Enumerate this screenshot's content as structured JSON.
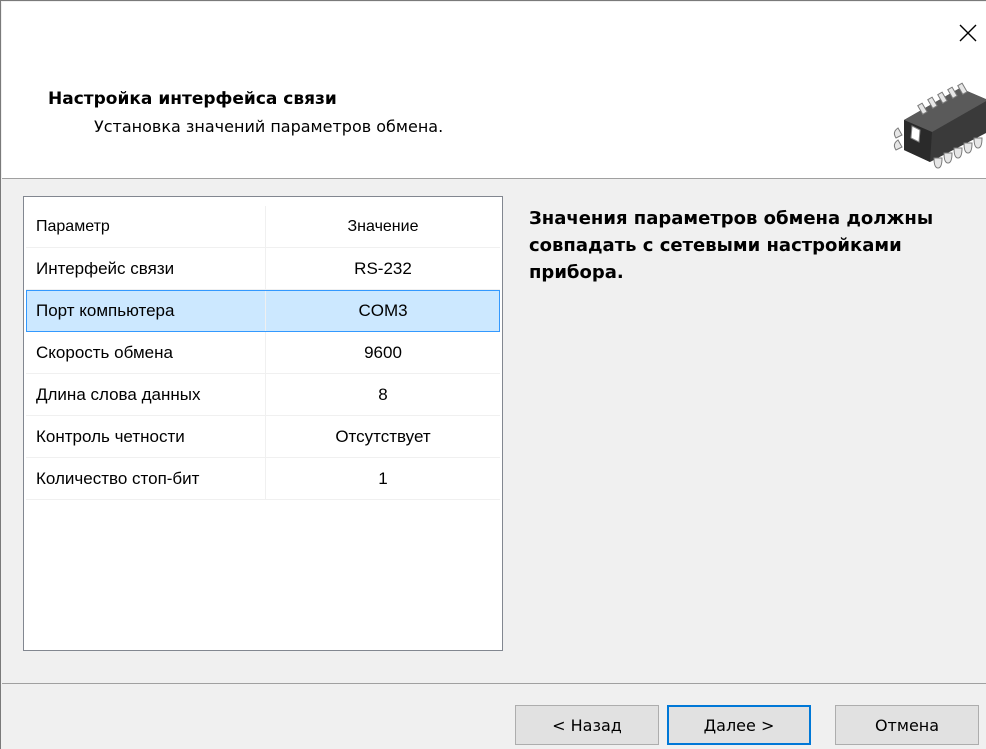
{
  "header": {
    "title": "Настройка интерфейса связи",
    "subtitle": "Установка значений параметров обмена.",
    "close_icon": "close-icon",
    "wizard_icon": "chip-icon"
  },
  "table": {
    "columns": [
      "Параметр",
      "Значение"
    ],
    "rows": [
      {
        "param": "Интерфейс связи",
        "value": "RS-232"
      },
      {
        "param": "Порт компьютера",
        "value": "COM3"
      },
      {
        "param": "Скорость обмена",
        "value": "9600"
      },
      {
        "param": "Длина слова данных",
        "value": "8"
      },
      {
        "param": "Контроль четности",
        "value": "Отсутствует"
      },
      {
        "param": "Количество стоп-бит",
        "value": "1"
      }
    ],
    "selected_row": "Порт компьютера"
  },
  "info": {
    "text": "Значения параметров обмена должны совпадать с сетевыми настройками прибора."
  },
  "buttons": {
    "back": "< Назад",
    "next": "Далее >",
    "cancel": "Отмена"
  },
  "colors": {
    "selection_bg": "#cce8ff",
    "selection_border": "#3399ff",
    "default_button_border": "#0078d7"
  }
}
